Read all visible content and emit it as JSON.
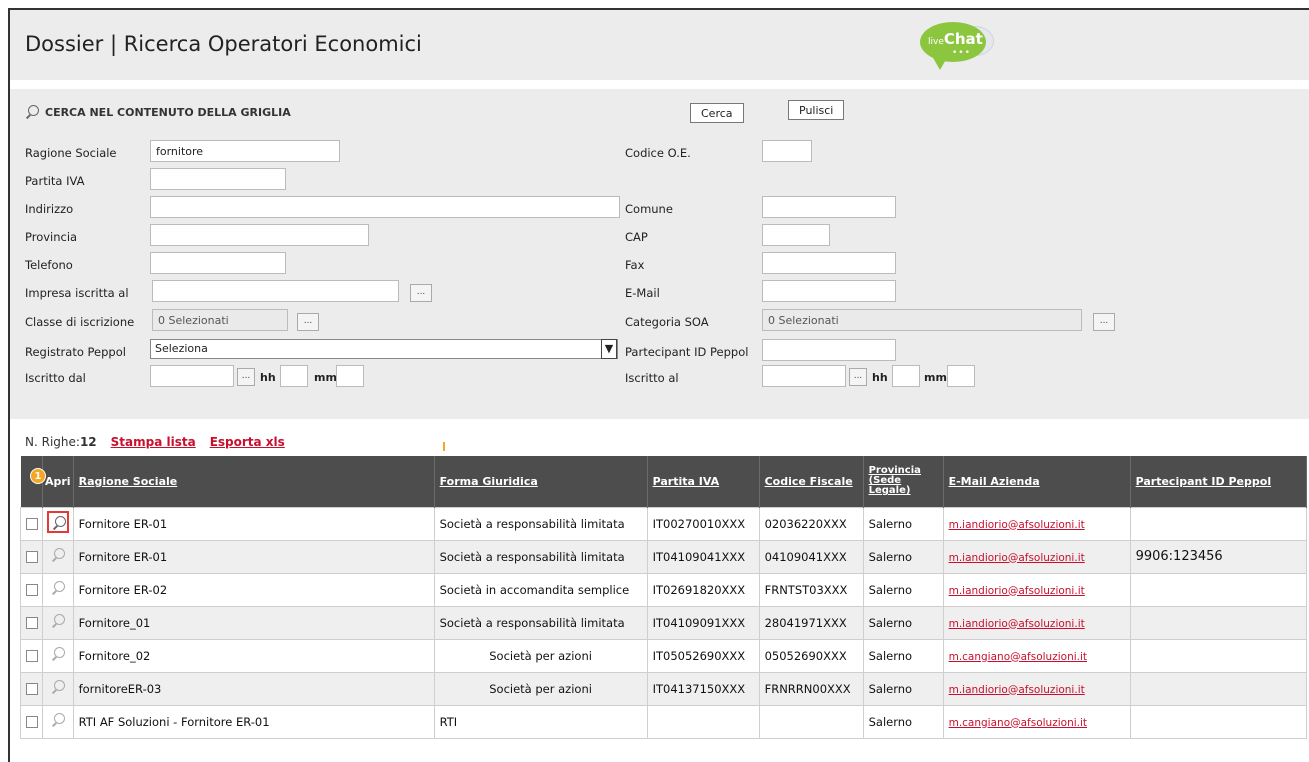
{
  "header": {
    "title": "Dossier | Ricerca Operatori Economici",
    "livechat_small": "live",
    "livechat_big": "Chat",
    "livechat_dots": "•••"
  },
  "search": {
    "heading": "CERCA NEL CONTENUTO DELLA GRIGLIA",
    "search_button": "Cerca",
    "clear_button": "Pulisci",
    "fields": {
      "ragione_sociale": {
        "label": "Ragione Sociale",
        "value": "fornitore"
      },
      "codice_oe": {
        "label": "Codice O.E.",
        "value": ""
      },
      "partita_iva": {
        "label": "Partita IVA",
        "value": ""
      },
      "indirizzo": {
        "label": "Indirizzo",
        "value": ""
      },
      "comune": {
        "label": "Comune",
        "value": ""
      },
      "provincia": {
        "label": "Provincia",
        "value": ""
      },
      "cap": {
        "label": "CAP",
        "value": ""
      },
      "telefono": {
        "label": "Telefono",
        "value": ""
      },
      "fax": {
        "label": "Fax",
        "value": ""
      },
      "impresa_iscritta": {
        "label": "Impresa iscritta al",
        "value": ""
      },
      "email": {
        "label": "E-Mail",
        "value": ""
      },
      "classe_iscrizione": {
        "label": "Classe di iscrizione",
        "value": "0 Selezionati"
      },
      "categoria_soa": {
        "label": "Categoria SOA",
        "value": "0 Selezionati"
      },
      "registrato_peppol": {
        "label": "Registrato Peppol",
        "value": "Seleziona"
      },
      "partecipant_id": {
        "label": "Partecipant ID Peppol",
        "value": ""
      },
      "iscritto_dal": {
        "label": "Iscritto dal",
        "value": ""
      },
      "iscritto_al": {
        "label": "Iscritto al",
        "value": ""
      }
    },
    "ellipsis": "...",
    "hh": "hh",
    "mm": "mm"
  },
  "results": {
    "count_label": "N. Righe:",
    "count": "12",
    "print_link": "Stampa lista",
    "export_link": "Esporta xls"
  },
  "table": {
    "headers": {
      "apri": "Apri",
      "ragione_sociale": "Ragione Sociale",
      "forma_giuridica": "Forma Giuridica",
      "partita_iva": "Partita IVA",
      "codice_fiscale": "Codice Fiscale",
      "provincia_1": "Provincia",
      "provincia_2": "(Sede",
      "provincia_3": "Legale)",
      "email": "E-Mail Azienda",
      "peppol": "Partecipant ID Peppol"
    },
    "badge": "1",
    "rows": [
      {
        "ragione": "Fornitore ER-01",
        "forma": "Società a responsabilità limitata",
        "piva": "IT00270010XXX",
        "cf": "02036220XXX",
        "prov": "Salerno",
        "email": "m.iandiorio@afsoluzioni.it",
        "peppol": ""
      },
      {
        "ragione": "Fornitore ER-01",
        "forma": "Società a responsabilità limitata",
        "piva": "IT04109041XXX",
        "cf": "04109041XXX",
        "prov": "Salerno",
        "email": "m.iandiorio@afsoluzioni.it",
        "peppol": "9906:123456"
      },
      {
        "ragione": "Fornitore ER-02",
        "forma": "Società in accomandita semplice",
        "piva": "IT02691820XXX",
        "cf": "FRNTST03XXX",
        "prov": "Salerno",
        "email": "m.iandiorio@afsoluzioni.it",
        "peppol": ""
      },
      {
        "ragione": "Fornitore_01",
        "forma": "Società a responsabilità limitata",
        "piva": "IT04109091XXX",
        "cf": "28041971XXX",
        "prov": "Salerno",
        "email": "m.iandiorio@afsoluzioni.it",
        "peppol": ""
      },
      {
        "ragione": "Fornitore_02",
        "forma": "Società per azioni",
        "piva": "IT05052690XXX",
        "cf": "05052690XXX",
        "prov": "Salerno",
        "email": "m.cangiano@afsoluzioni.it",
        "peppol": ""
      },
      {
        "ragione": "fornitoreER-03",
        "forma": "Società per azioni",
        "piva": "IT04137150XXX",
        "cf": "FRNRRN00XXX",
        "prov": "Salerno",
        "email": "m.iandiorio@afsoluzioni.it",
        "peppol": ""
      },
      {
        "ragione": "RTI AF Soluzioni - Fornitore ER-01",
        "forma": "RTI",
        "piva": "",
        "cf": "",
        "prov": "Salerno",
        "email": "m.cangiano@afsoluzioni.it",
        "peppol": ""
      }
    ]
  }
}
